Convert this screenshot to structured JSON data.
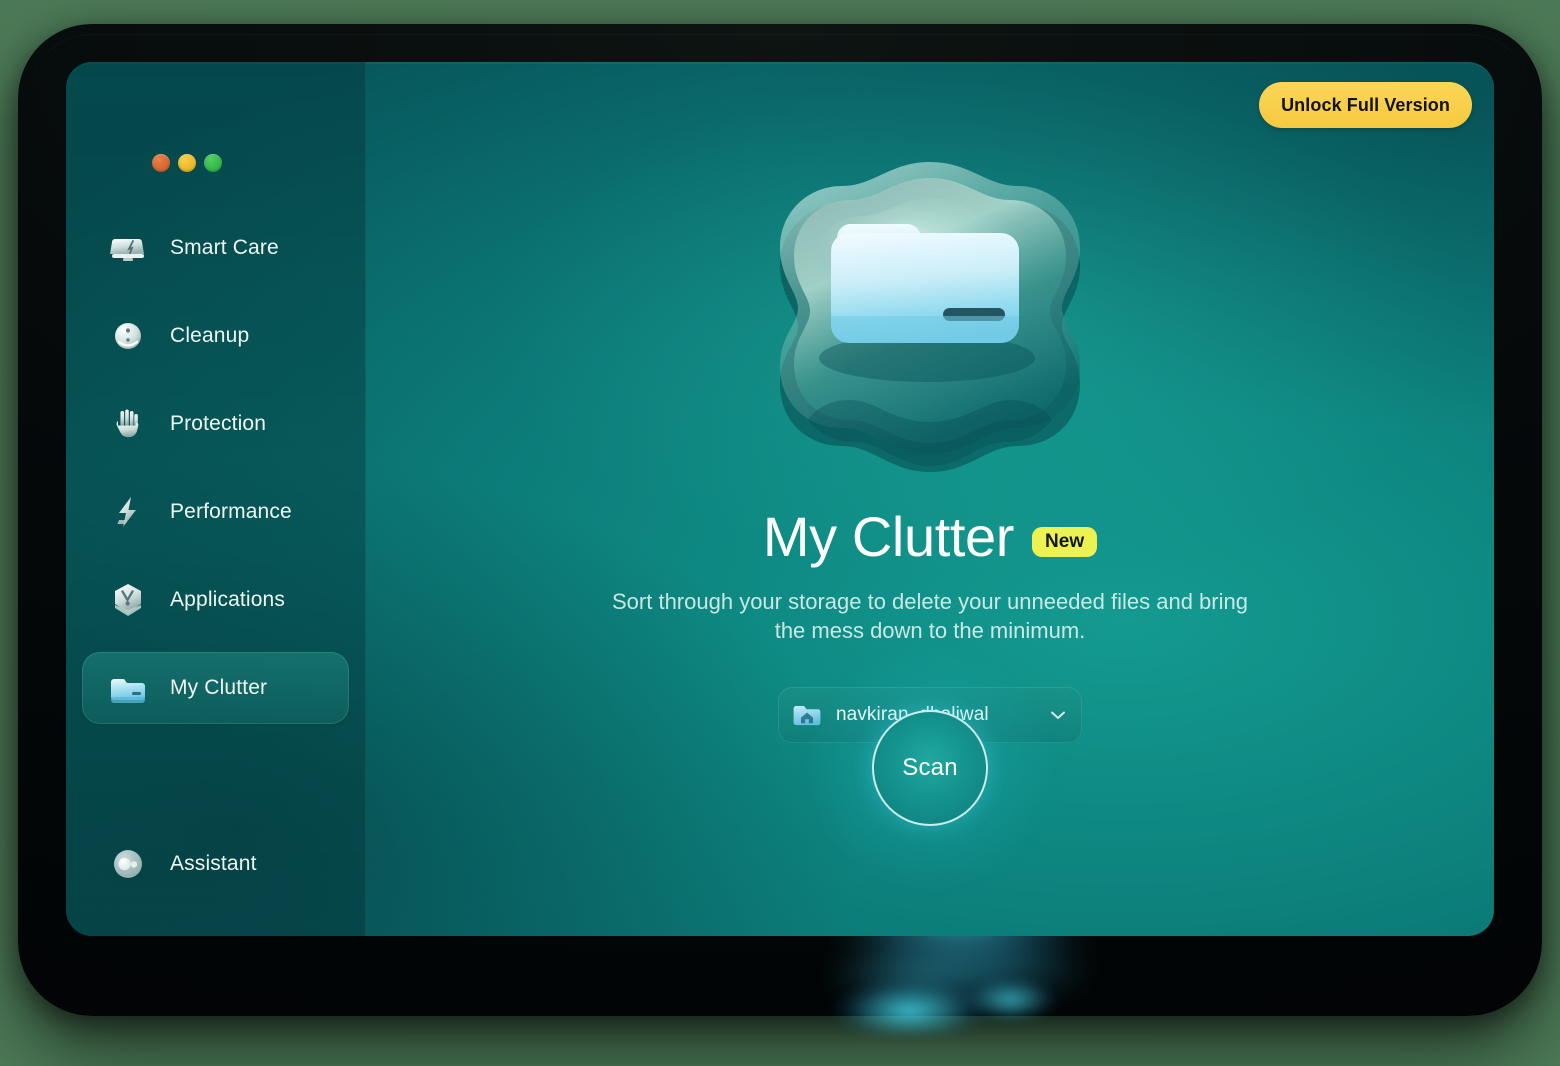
{
  "window": {
    "traffic_lights": [
      {
        "name": "close",
        "color": "#d2622c"
      },
      {
        "name": "minimize",
        "color": "#e8b425"
      },
      {
        "name": "zoom",
        "color": "#2eb345"
      }
    ],
    "background_color": "#0b7073"
  },
  "header": {
    "unlock_label": "Unlock Full Version",
    "unlock_color": "#f6c93f"
  },
  "sidebar": {
    "items": [
      {
        "label": "Smart Care",
        "icon": "laptop-care-icon",
        "active": false
      },
      {
        "label": "Cleanup",
        "icon": "cleanup-bot-icon",
        "active": false
      },
      {
        "label": "Protection",
        "icon": "hand-shield-icon",
        "active": false
      },
      {
        "label": "Performance",
        "icon": "lightning-bolt-icon",
        "active": false
      },
      {
        "label": "Applications",
        "icon": "app-hexagon-icon",
        "active": false
      },
      {
        "label": "My Clutter",
        "icon": "folder-icon",
        "active": true
      }
    ],
    "bottom_items": [
      {
        "label": "Assistant",
        "icon": "assistant-orb-icon",
        "active": false
      }
    ]
  },
  "main": {
    "hero_icon": "folder-blob-illustration",
    "title": "My Clutter",
    "badge": "New",
    "badge_color": "#ecf251",
    "subtitle": "Sort through your storage to delete your unneeded files and bring the mess down to the minimum.",
    "folder_select": {
      "icon": "home-folder-icon",
      "value": "navkiran_dhaliwal",
      "chevron": "chevron-down-icon"
    },
    "scan_label": "Scan"
  }
}
